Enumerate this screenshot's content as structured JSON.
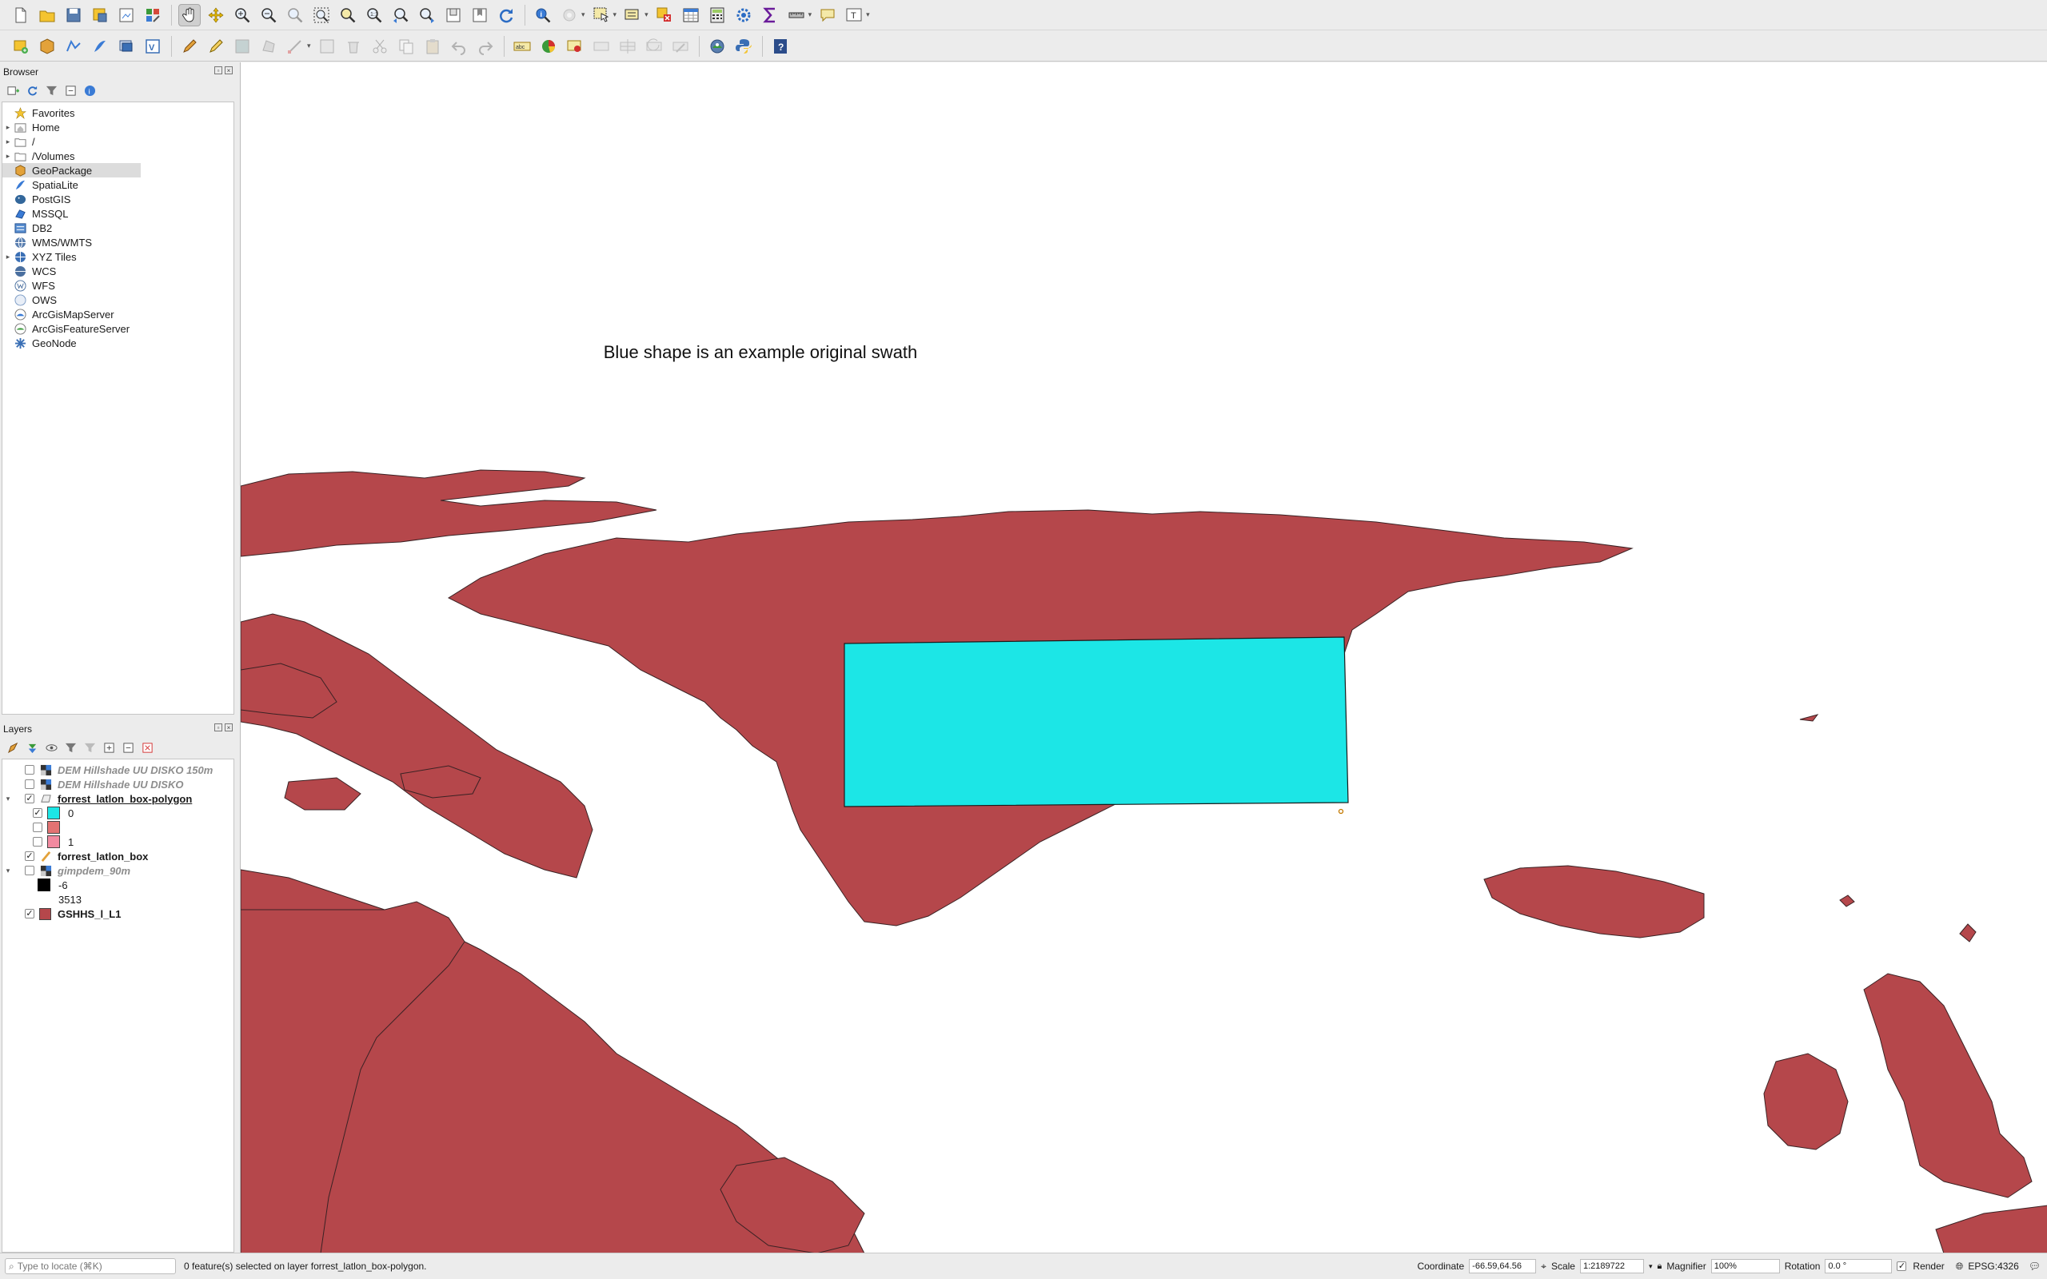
{
  "toolbar1": {
    "tools": [
      "new-project",
      "open-project",
      "save-project",
      "save-as",
      "print-layout",
      "style-manager",
      "pan",
      "pan-to-selection",
      "zoom-in",
      "zoom-out",
      "zoom-full",
      "zoom-to-selection",
      "zoom-to-layer",
      "zoom-to-native",
      "zoom-last",
      "zoom-next",
      "new-bookmark",
      "show-bookmarks",
      "refresh",
      "identify",
      "actions",
      "select-features",
      "select-by-value",
      "deselect",
      "attribute-table",
      "field-calculator",
      "processing-toolbox",
      "statistics",
      "measure",
      "map-tips",
      "text-annotation"
    ]
  },
  "toolbar2": {
    "tools": [
      "data-source-manager",
      "new-geopackage",
      "new-shapefile",
      "new-spatialite",
      "new-virtual-layer",
      "digitize-current-edits",
      "toggle-editing",
      "save-edits",
      "add-polygon",
      "vertex-tool",
      "modify-attributes",
      "delete-selected",
      "cut",
      "copy",
      "paste",
      "undo",
      "redo",
      "label-tool",
      "diagram",
      "pin-labels",
      "show-hide-labels",
      "move-label",
      "rotate-label",
      "change-label",
      "georeferencer",
      "python-console",
      "help"
    ]
  },
  "browser": {
    "title": "Browser",
    "items": [
      {
        "label": "Favorites",
        "icon": "star-icon",
        "arrow": ""
      },
      {
        "label": "Home",
        "icon": "home-folder-icon",
        "arrow": "▸"
      },
      {
        "label": "/",
        "icon": "folder-icon",
        "arrow": "▸"
      },
      {
        "label": "/Volumes",
        "icon": "folder-icon",
        "arrow": "▸"
      },
      {
        "label": "GeoPackage",
        "icon": "geopackage-icon",
        "arrow": ""
      },
      {
        "label": "SpatiaLite",
        "icon": "spatialite-icon",
        "arrow": ""
      },
      {
        "label": "PostGIS",
        "icon": "postgis-icon",
        "arrow": ""
      },
      {
        "label": "MSSQL",
        "icon": "mssql-icon",
        "arrow": ""
      },
      {
        "label": "DB2",
        "icon": "db2-icon",
        "arrow": ""
      },
      {
        "label": "WMS/WMTS",
        "icon": "wms-icon",
        "arrow": ""
      },
      {
        "label": "XYZ Tiles",
        "icon": "xyz-tiles-icon",
        "arrow": "▸"
      },
      {
        "label": "WCS",
        "icon": "wcs-icon",
        "arrow": ""
      },
      {
        "label": "WFS",
        "icon": "wfs-icon",
        "arrow": ""
      },
      {
        "label": "OWS",
        "icon": "ows-icon",
        "arrow": ""
      },
      {
        "label": "ArcGisMapServer",
        "icon": "arcgis-map-icon",
        "arrow": ""
      },
      {
        "label": "ArcGisFeatureServer",
        "icon": "arcgis-feature-icon",
        "arrow": ""
      },
      {
        "label": "GeoNode",
        "icon": "geonode-icon",
        "arrow": ""
      }
    ]
  },
  "layers": {
    "title": "Layers",
    "rows": [
      {
        "label": "DEM Hillshade UU DISKO 150m"
      },
      {
        "label": "DEM Hillshade UU DISKO"
      },
      {
        "label": "forrest_latlon_box-polygon"
      },
      {
        "label": "0"
      },
      {
        "label": ""
      },
      {
        "label": "1"
      },
      {
        "label": "forrest_latlon_box"
      },
      {
        "label": "gimpdem_90m"
      },
      {
        "label": "-6"
      },
      {
        "label": "3513"
      },
      {
        "label": "GSHHS_l_L1"
      }
    ]
  },
  "map": {
    "annotation": "Blue shape is an example original swath",
    "land_color": "#b5474b",
    "swath_color": "#1ce6e6"
  },
  "status": {
    "locate_placeholder": "Type to locate (⌘K)",
    "message": "0 feature(s) selected on layer forrest_latlon_box-polygon.",
    "coordinate_label": "Coordinate",
    "coordinate_value": "-66.59,64.56",
    "scale_label": "Scale",
    "scale_value": "1:2189722",
    "magnifier_label": "Magnifier",
    "magnifier_value": "100%",
    "rotation_label": "Rotation",
    "rotation_value": "0.0 °",
    "render_label": "Render",
    "crs": "EPSG:4326"
  }
}
